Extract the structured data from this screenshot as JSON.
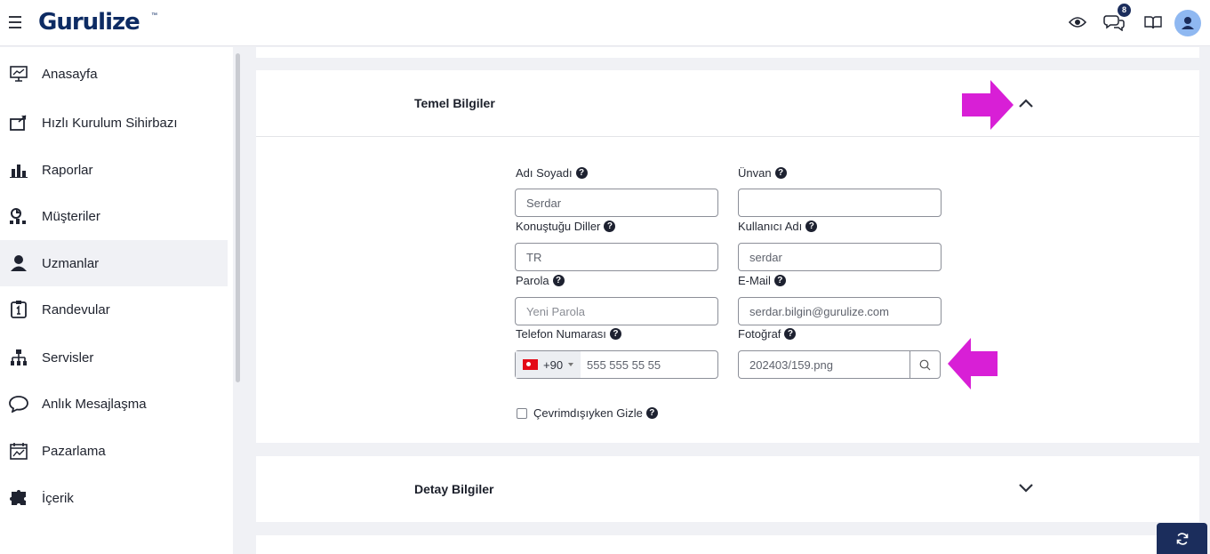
{
  "header": {
    "logo": "Gurulize",
    "logo_tm": "™",
    "notification_count": "8",
    "icons": [
      "menu-icon",
      "eye-icon",
      "chat-icon",
      "book-icon",
      "user-avatar"
    ]
  },
  "sidebar": {
    "items": [
      {
        "label": "Anasayfa",
        "icon": "monitor-chart-icon"
      },
      {
        "label": "Hızlı Kurulum Sihirbazı",
        "icon": "wizard-icon"
      },
      {
        "label": "Raporlar",
        "icon": "bar-chart-icon"
      },
      {
        "label": "Müşteriler",
        "icon": "customers-icon"
      },
      {
        "label": "Uzmanlar",
        "icon": "expert-icon",
        "active": true
      },
      {
        "label": "Randevular",
        "icon": "appointment-icon"
      },
      {
        "label": "Servisler",
        "icon": "sitemap-icon"
      },
      {
        "label": "Anlık Mesajlaşma",
        "icon": "chat-bubble-icon"
      },
      {
        "label": "Pazarlama",
        "icon": "calendar-chart-icon"
      },
      {
        "label": "İçerik",
        "icon": "puzzle-icon"
      }
    ]
  },
  "sections": {
    "basic": {
      "title": "Temel Bilgiler",
      "fields": {
        "full_name": {
          "label": "Adı Soyadı",
          "value": "Serdar"
        },
        "title": {
          "label": "Ünvan",
          "value": ""
        },
        "languages": {
          "label": "Konuştuğu Diller",
          "value": "TR"
        },
        "username": {
          "label": "Kullanıcı Adı",
          "value": "serdar"
        },
        "password": {
          "label": "Parola",
          "placeholder": "Yeni Parola"
        },
        "email": {
          "label": "E-Mail",
          "value": "serdar.bilgin@gurulize.com"
        },
        "phone": {
          "label": "Telefon Numarası",
          "country_code": "+90",
          "value": "555 555 55 55"
        },
        "photo": {
          "label": "Fotoğraf",
          "value": "202403/159.png"
        }
      },
      "hide_offline": {
        "label": "Çevrimdışıyken Gizle",
        "checked": false
      }
    },
    "detail": {
      "title": "Detay Bilgiler"
    }
  },
  "colors": {
    "brand": "#0d2b63",
    "accent_arrow": "#d81fd6",
    "dark_button": "#1b2d5c",
    "avatar": "#8fb8f1"
  }
}
